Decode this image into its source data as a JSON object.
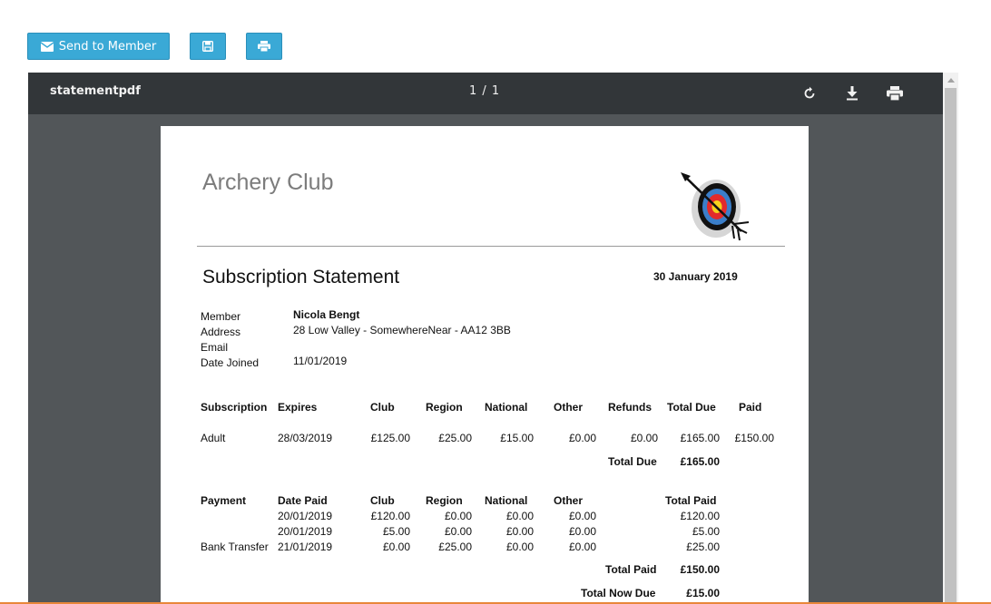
{
  "actions": {
    "send_label": "Send to Member",
    "save_icon": "floppy-disk-icon",
    "print_icon": "printer-icon"
  },
  "viewer": {
    "title": "statementpdf",
    "page_indicator": "1 / 1",
    "icons": [
      "rotate-icon",
      "download-icon",
      "printer-icon"
    ]
  },
  "statement": {
    "club_name": "Archery Club",
    "title": "Subscription Statement",
    "date": "30 January 2019",
    "member": {
      "labels": [
        "Member",
        "Address",
        "Email",
        "Date Joined"
      ],
      "name": "Nicola Bengt",
      "address": "28 Low Valley - SomewhereNear - AA12 3BB",
      "email": "",
      "date_joined": "11/01/2019"
    },
    "subscription": {
      "headers": [
        "Subscription",
        "Expires",
        "Club",
        "Region",
        "National",
        "Other",
        "Refunds",
        "Total Due",
        "Paid"
      ],
      "rows": [
        [
          "Adult",
          "28/03/2019",
          "£125.00",
          "£25.00",
          "£15.00",
          "£0.00",
          "£0.00",
          "£165.00",
          "£150.00"
        ]
      ],
      "total_due_label": "Total Due",
      "total_due_value": "£165.00"
    },
    "payments": {
      "headers": [
        "Payment",
        "Date Paid",
        "Club",
        "Region",
        "National",
        "Other",
        "Total Paid"
      ],
      "rows": [
        [
          "",
          "20/01/2019",
          "£120.00",
          "£0.00",
          "£0.00",
          "£0.00",
          "£120.00"
        ],
        [
          "",
          "20/01/2019",
          "£5.00",
          "£0.00",
          "£0.00",
          "£0.00",
          "£5.00"
        ],
        [
          "Bank Transfer",
          "21/01/2019",
          "£0.00",
          "£25.00",
          "£0.00",
          "£0.00",
          "£25.00"
        ]
      ],
      "total_paid_label": "Total Paid",
      "total_paid_value": "£150.00",
      "total_now_due_label": "Total Now Due",
      "total_now_due_value": "£15.00"
    }
  },
  "colors": {
    "button": "#3aa9d6",
    "viewer_bg": "#525659",
    "toolbar_bg": "#323639",
    "accent_line": "#e8873a"
  }
}
